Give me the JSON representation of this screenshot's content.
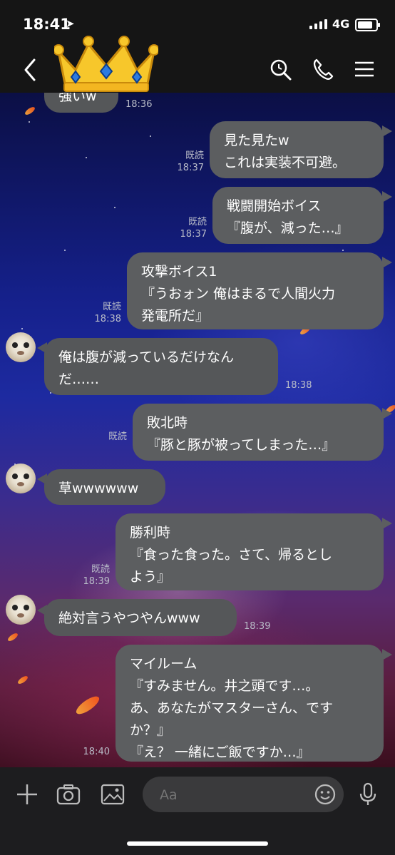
{
  "status": {
    "time": "18:41",
    "network": "4G"
  },
  "header": {
    "back": "back",
    "search": "search",
    "call": "call",
    "menu": "menu"
  },
  "messages": [
    {
      "dir": "in",
      "text": "強いw",
      "time": "18:36"
    },
    {
      "dir": "out",
      "text": "見た見たw\nこれは実装不可避。",
      "read": "既読",
      "time": "18:37"
    },
    {
      "dir": "out",
      "text": "戦闘開始ボイス\n『腹が、減った…』",
      "read": "既読",
      "time": "18:37"
    },
    {
      "dir": "out",
      "text": "攻撃ボイス1\n『うおォン 俺はまるで人間火力\n発電所だ』",
      "read": "既読",
      "time": "18:38"
    },
    {
      "dir": "in",
      "text": "俺は腹が減っているだけなん\nだ……",
      "time": "18:38"
    },
    {
      "dir": "out",
      "text": "敗北時\n『豚と豚が被ってしまった…』",
      "read": "既読",
      "time": ""
    },
    {
      "dir": "in",
      "text": "草wwwwww",
      "time": ""
    },
    {
      "dir": "out",
      "text": "勝利時\n『食った食った。さて、帰るとし\nよう』",
      "read": "既読",
      "time": "18:39"
    },
    {
      "dir": "in",
      "text": "絶対言うやつやんwww",
      "time": "18:39"
    },
    {
      "dir": "out",
      "text": "マイルーム\n『すみません。井之頭です…。\nあ、あなたがマスターさん、です\nか？』\n『え？ 一緒にご飯ですか…』",
      "read": "",
      "time": "18:40"
    }
  ],
  "composer": {
    "placeholder": "Aa"
  },
  "icons": {
    "plus": "plus-icon",
    "camera": "camera-icon",
    "image": "image-icon",
    "emoji": "emoji-icon",
    "mic": "microphone-icon",
    "crown": "crown-icon"
  }
}
